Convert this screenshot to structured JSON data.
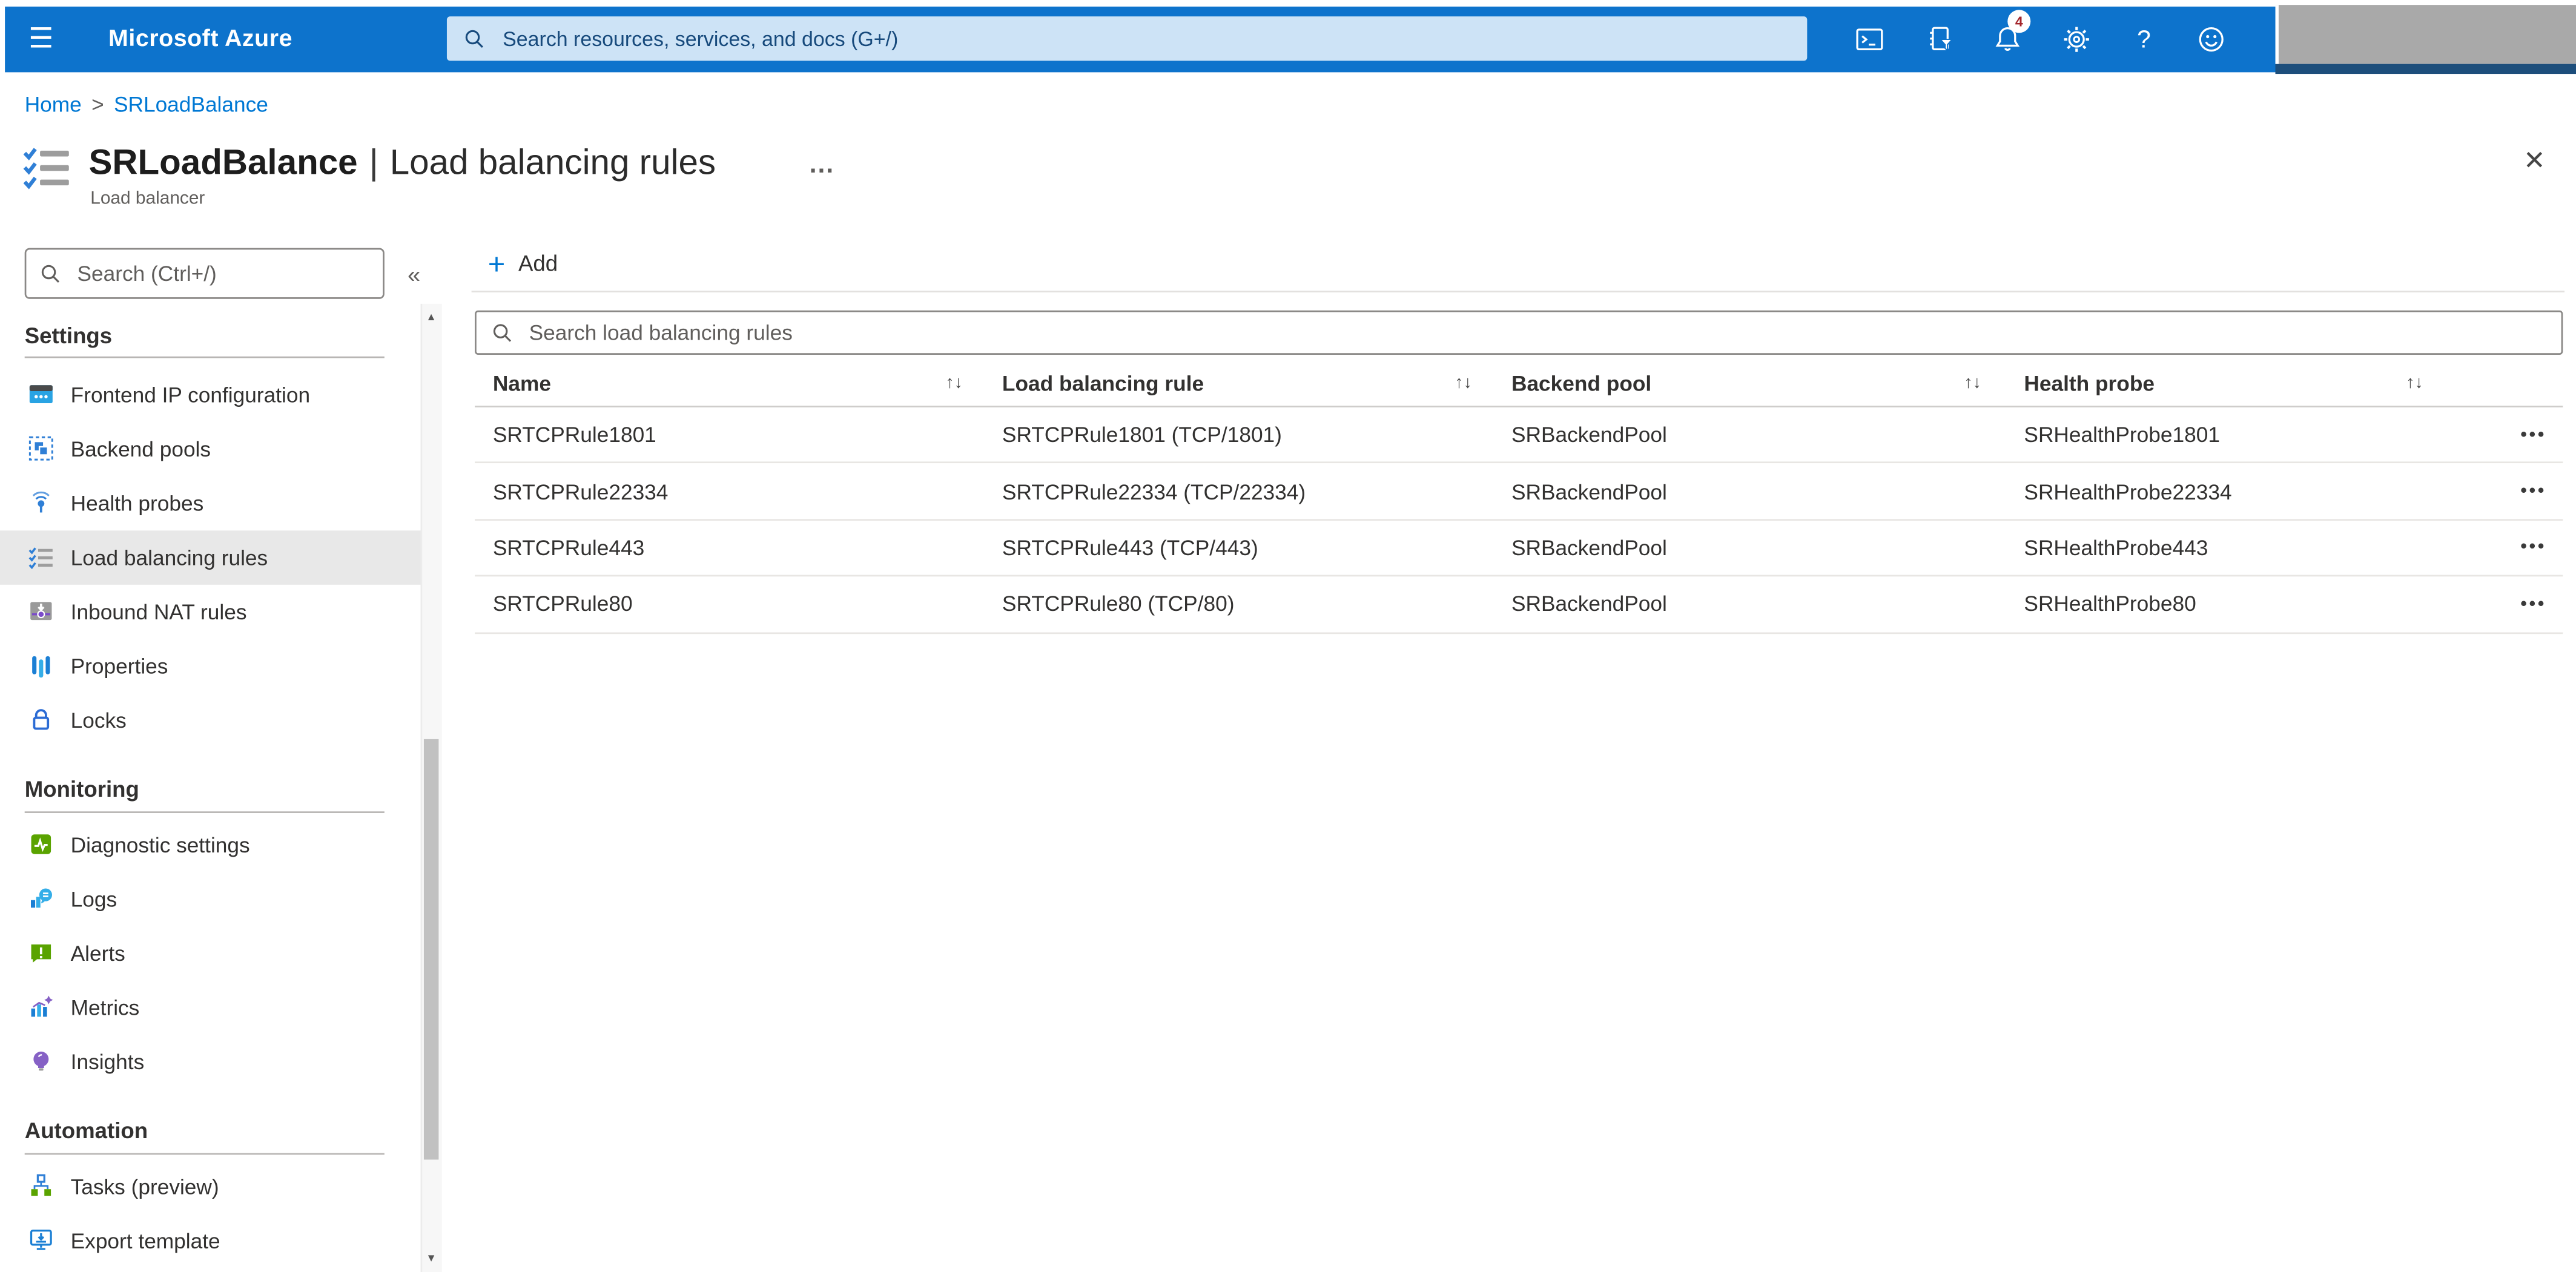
{
  "topbar": {
    "brand": "Microsoft Azure",
    "search_placeholder": "Search resources, services, and docs (G+/)",
    "notification_count": "4"
  },
  "icons": {
    "hamburger": "☰",
    "breadcrumb_separator": ">",
    "ellipsis": "…",
    "close": "✕",
    "sidebar_collapse": "«",
    "sort": "↑↓",
    "row_menu": "•••",
    "add_plus": "+",
    "scroll_up": "▲",
    "scroll_down": "▼",
    "help": "?"
  },
  "breadcrumb": [
    "Home",
    "SRLoadBalance"
  ],
  "page": {
    "title": "SRLoadBalance",
    "separator": "|",
    "section": "Load balancing rules",
    "subtitle": "Load balancer"
  },
  "sidebar": {
    "search_placeholder": "Search (Ctrl+/)",
    "sections": [
      {
        "label": "Settings",
        "items": [
          {
            "label": "Frontend IP configuration"
          },
          {
            "label": "Backend pools"
          },
          {
            "label": "Health probes"
          },
          {
            "label": "Load balancing rules"
          },
          {
            "label": "Inbound NAT rules"
          },
          {
            "label": "Properties"
          },
          {
            "label": "Locks"
          }
        ]
      },
      {
        "label": "Monitoring",
        "items": [
          {
            "label": "Diagnostic settings"
          },
          {
            "label": "Logs"
          },
          {
            "label": "Alerts"
          },
          {
            "label": "Metrics"
          },
          {
            "label": "Insights"
          }
        ]
      },
      {
        "label": "Automation",
        "items": [
          {
            "label": "Tasks (preview)"
          },
          {
            "label": "Export template"
          }
        ]
      }
    ]
  },
  "toolbar": {
    "add_label": "Add"
  },
  "table": {
    "search_placeholder": "Search load balancing rules",
    "columns": [
      "Name",
      "Load balancing rule",
      "Backend pool",
      "Health probe"
    ],
    "rows": [
      {
        "name": "SRTCPRule1801",
        "rule": "SRTCPRule1801 (TCP/1801)",
        "backend_pool": "SRBackendPool",
        "health_probe": "SRHealthProbe1801"
      },
      {
        "name": "SRTCPRule22334",
        "rule": "SRTCPRule22334 (TCP/22334)",
        "backend_pool": "SRBackendPool",
        "health_probe": "SRHealthProbe22334"
      },
      {
        "name": "SRTCPRule443",
        "rule": "SRTCPRule443 (TCP/443)",
        "backend_pool": "SRBackendPool",
        "health_probe": "SRHealthProbe443"
      },
      {
        "name": "SRTCPRule80",
        "rule": "SRTCPRule80 (TCP/80)",
        "backend_pool": "SRBackendPool",
        "health_probe": "SRHealthProbe80"
      }
    ]
  },
  "colors": {
    "topbar_blue": "#0d73cc",
    "accent_blue": "#0078d4",
    "search_pill_bg": "#cde3f6",
    "text_dark": "#323130",
    "text_gray": "#605e5c",
    "selected_bg": "#e8e8e8",
    "badge_red": "#a4262c",
    "redaction_gray": "#a9a9a9",
    "redaction_navy": "#1d4e7b"
  }
}
